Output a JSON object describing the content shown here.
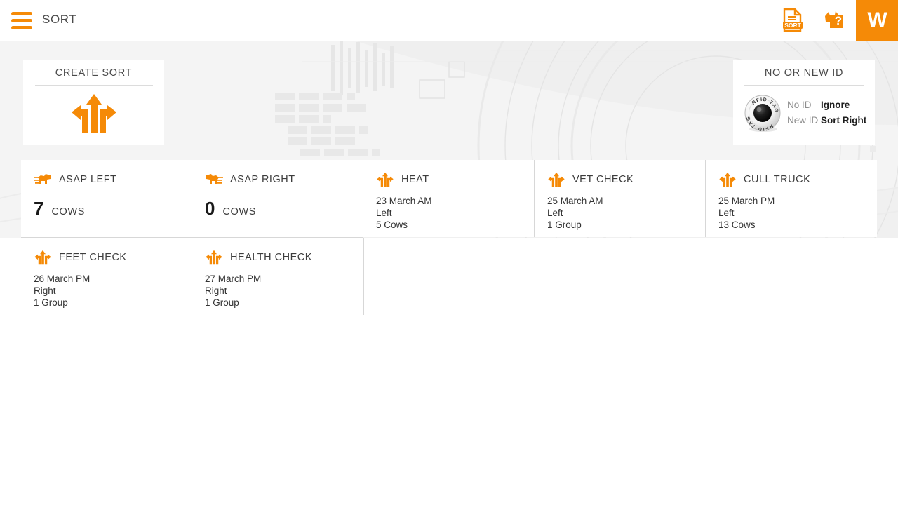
{
  "topbar": {
    "menu_icon": "hamburger-menu-icon",
    "title": "SORT",
    "sort_report_icon": "sort-document-icon",
    "sort_report_icon_label": "SORT",
    "help_icon": "cow-help-icon",
    "brand_logo": "W",
    "accent_color": "#f58a07"
  },
  "create_sort": {
    "title": "CREATE SORT",
    "icon": "three-way-arrow-icon"
  },
  "no_or_new_id": {
    "title": "NO OR NEW ID",
    "tag_icon": "rfid-tag-icon",
    "tag_icon_text": "RFID TAG",
    "rows": [
      {
        "label": "No ID",
        "value": "Ignore"
      },
      {
        "label": "New ID",
        "value": "Sort Right"
      }
    ]
  },
  "sort_cards": [
    {
      "title": "ASAP LEFT",
      "icon": "cow-running-left-icon",
      "type": "count",
      "count": "7",
      "unit": "COWS"
    },
    {
      "title": "ASAP RIGHT",
      "icon": "cow-running-right-icon",
      "type": "count",
      "count": "0",
      "unit": "COWS"
    },
    {
      "title": "HEAT",
      "icon": "three-way-arrow-icon",
      "type": "detail",
      "date": "23 March AM",
      "direction": "Left",
      "quantity": "5 Cows"
    },
    {
      "title": "VET CHECK",
      "icon": "three-way-arrow-icon",
      "type": "detail",
      "date": "25 March AM",
      "direction": "Left",
      "quantity": "1 Group"
    },
    {
      "title": "CULL TRUCK",
      "icon": "three-way-arrow-icon",
      "type": "detail",
      "date": "25 March PM",
      "direction": "Left",
      "quantity": "13 Cows"
    },
    {
      "title": "FEET CHECK",
      "icon": "three-way-arrow-icon",
      "type": "detail",
      "date": "26 March PM",
      "direction": "Right",
      "quantity": "1 Group"
    },
    {
      "title": "HEALTH CHECK",
      "icon": "three-way-arrow-icon",
      "type": "detail",
      "date": "27 March PM",
      "direction": "Right",
      "quantity": "1 Group"
    }
  ]
}
